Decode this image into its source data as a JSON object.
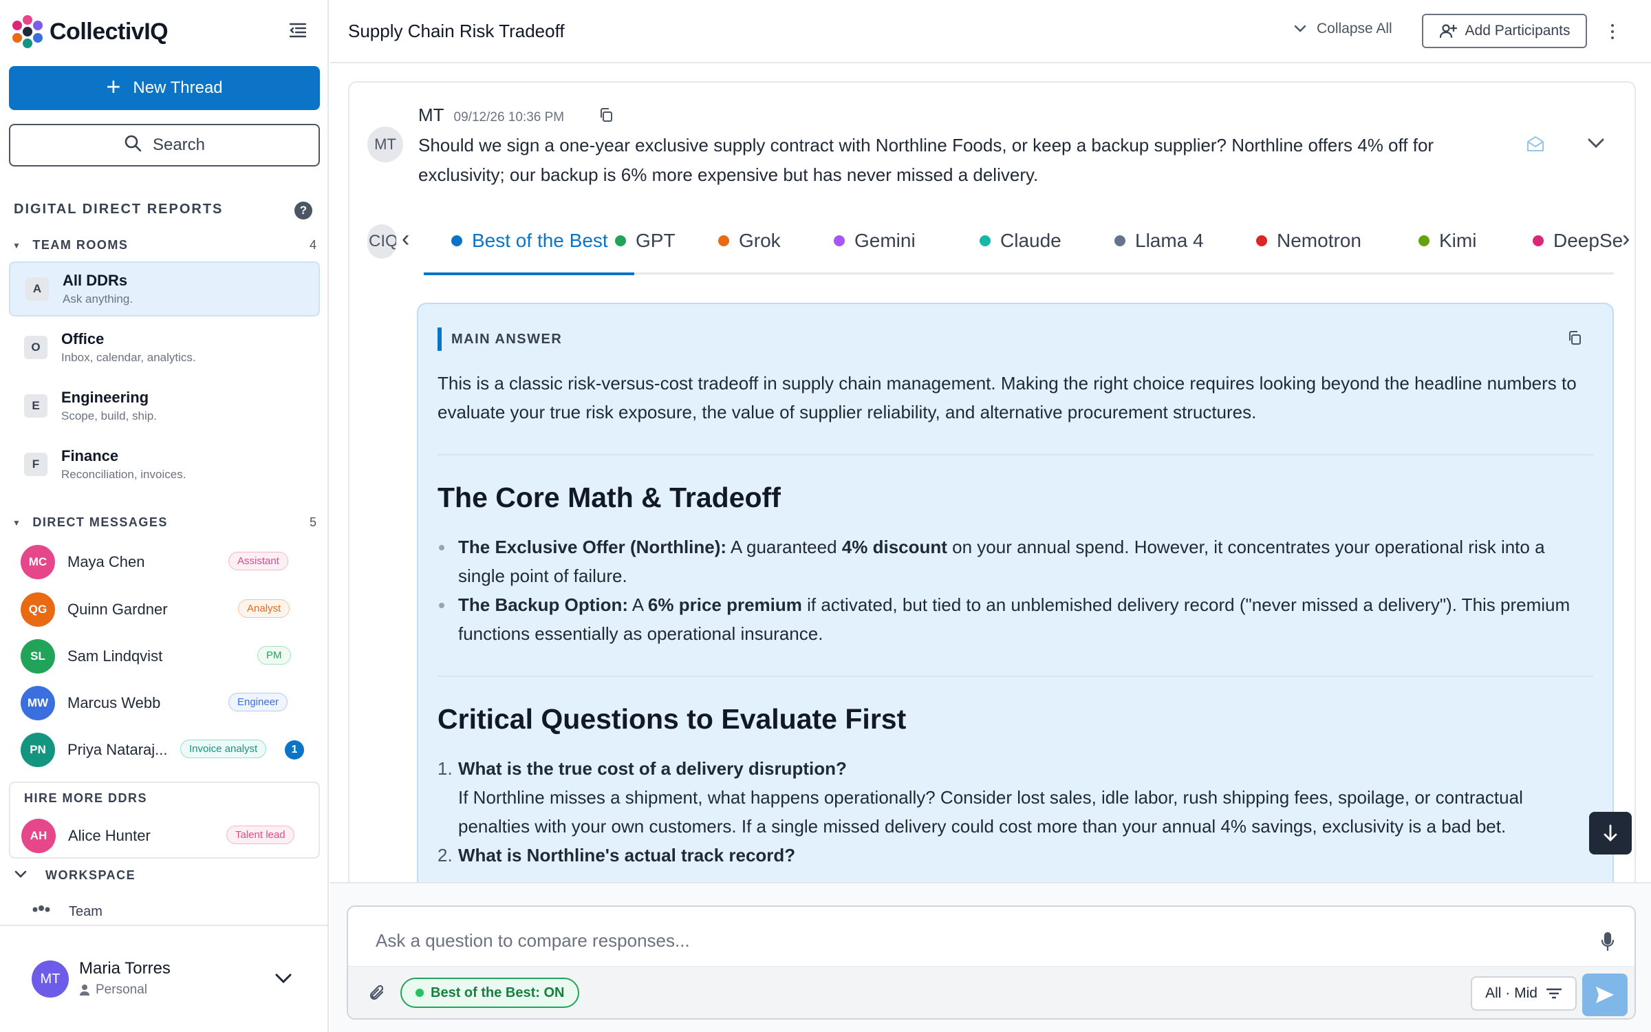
{
  "brand": {
    "name": "CollectivIQ"
  },
  "sidebar": {
    "new_thread": "New Thread",
    "search": "Search",
    "section_title": "DIGITAL DIRECT REPORTS",
    "help": "?",
    "team_rooms": {
      "label": "TEAM ROOMS",
      "count": "4",
      "items": [
        {
          "initial": "A",
          "name": "All DDRs",
          "desc": "Ask anything."
        },
        {
          "initial": "O",
          "name": "Office",
          "desc": "Inbox, calendar, analytics."
        },
        {
          "initial": "E",
          "name": "Engineering",
          "desc": "Scope, build, ship."
        },
        {
          "initial": "F",
          "name": "Finance",
          "desc": "Reconciliation, invoices."
        }
      ]
    },
    "direct_messages": {
      "label": "DIRECT MESSAGES",
      "count": "5",
      "items": [
        {
          "initials": "MC",
          "name": "Maya Chen",
          "role": "Assistant",
          "color": "#e5478a",
          "role_color": "#e5478a"
        },
        {
          "initials": "QG",
          "name": "Quinn Gardner",
          "role": "Analyst",
          "color": "#ea6a14",
          "role_color": "#ea6a14"
        },
        {
          "initials": "SL",
          "name": "Sam Lindqvist",
          "role": "PM",
          "color": "#22a35a",
          "role_color": "#22a35a"
        },
        {
          "initials": "MW",
          "name": "Marcus Webb",
          "role": "Engineer",
          "color": "#3b6fe0",
          "role_color": "#3b6fe0"
        },
        {
          "initials": "PN",
          "name": "Priya Nataraj...",
          "role": "Invoice analyst",
          "color": "#14957f",
          "role_color": "#14957f",
          "unread": "1"
        }
      ]
    },
    "hire": {
      "label": "HIRE MORE DDRS",
      "item": {
        "initials": "AH",
        "name": "Alice Hunter",
        "role": "Talent lead",
        "color": "#e5478a",
        "role_color": "#e5478a"
      }
    },
    "workspace": {
      "label": "WORKSPACE",
      "item": "Team"
    },
    "user": {
      "initials": "MT",
      "name": "Maria Torres",
      "type": "Personal"
    }
  },
  "header": {
    "title": "Supply Chain Risk Tradeoff",
    "collapse_all": "Collapse All",
    "add_participants": "Add Participants"
  },
  "message": {
    "avatar": "MT",
    "author": "MT",
    "time": "09/12/26 10:36 PM",
    "text": "Should we sign a one-year exclusive supply contract with Northline Foods, or keep a backup supplier? Northline offers 4% off for exclusivity; our backup is 6% more expensive but has never missed a delivery."
  },
  "tabs": {
    "ciq": "CIQ",
    "items": [
      {
        "label": "Best of the Best",
        "color": "#0b74c6"
      },
      {
        "label": "GPT",
        "color": "#22a35a"
      },
      {
        "label": "Grok",
        "color": "#ea6a14"
      },
      {
        "label": "Gemini",
        "color": "#a855f7"
      },
      {
        "label": "Claude",
        "color": "#14b8a6"
      },
      {
        "label": "Llama 4",
        "color": "#64748b"
      },
      {
        "label": "Nemotron",
        "color": "#dc2626"
      },
      {
        "label": "Kimi",
        "color": "#65a30d"
      },
      {
        "label": "DeepSeek",
        "color": "#db2777"
      }
    ]
  },
  "answer": {
    "label": "MAIN ANSWER",
    "intro": "This is a classic risk-versus-cost tradeoff in supply chain management. Making the right choice requires looking beyond the headline numbers to evaluate your true risk exposure, the value of supplier reliability, and alternative procurement structures.",
    "h1": "The Core Math & Tradeoff",
    "b1_lead": "The Exclusive Offer (Northline):",
    "b1_pre": " A guaranteed ",
    "b1_strong": "4% discount",
    "b1_post": " on your annual spend. However, it concentrates your operational risk into a single point of failure.",
    "b2_lead": "The Backup Option:",
    "b2_pre": " A ",
    "b2_strong": "6% price premium",
    "b2_post": " if activated, but tied to an unblemished delivery record (\"never missed a delivery\"). This premium functions essentially as operational insurance.",
    "h2": "Critical Questions to Evaluate First",
    "q1_num": "1.",
    "q1_title": "What is the true cost of a delivery disruption?",
    "q1_text": "If Northline misses a shipment, what happens operationally? Consider lost sales, idle labor, rush shipping fees, spoilage, or contractual penalties with your own customers. If a single missed delivery could cost more than your annual 4% savings, exclusivity is a bad bet.",
    "q2_num": "2.",
    "q2_title": "What is Northline's actual track record?"
  },
  "composer": {
    "placeholder": "Ask a question to compare responses...",
    "best_toggle": "Best of the Best: ON",
    "filter": "All · Mid"
  }
}
